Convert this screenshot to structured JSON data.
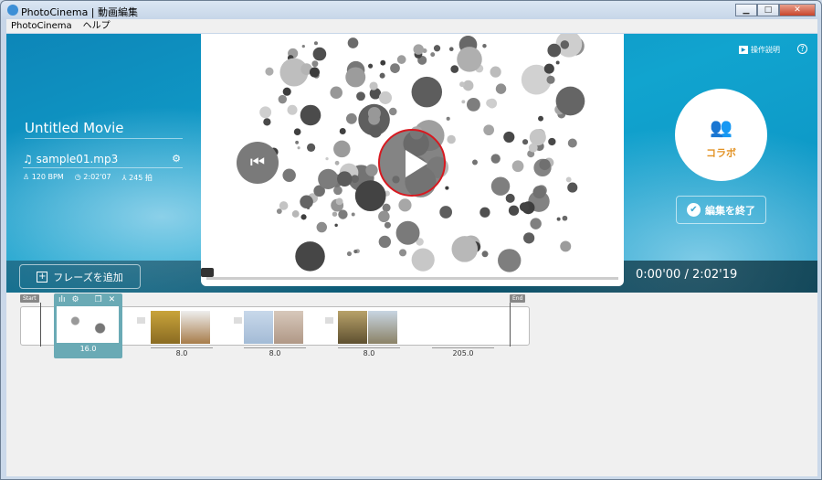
{
  "window": {
    "title": "PhotoCinema | 動画編集",
    "minimize": "▁",
    "maximize": "□",
    "close": "✕"
  },
  "menu": [
    "PhotoCinema",
    "ヘルプ"
  ],
  "movie": {
    "title": "Untitled Movie",
    "music_file": "sample01.mp3",
    "bpm": "120 BPM",
    "duration": "2:02'07",
    "beats": "245 拍"
  },
  "buttons": {
    "add_phrase": "フレーズを追加",
    "collab": "コラボ",
    "finish_editing": "編集を終了",
    "help": "操作説明",
    "question": "?"
  },
  "player": {
    "time": "0:00'00 / 2:02'19",
    "progress": 0
  },
  "timeline": {
    "start_label": "Start",
    "end_label": "End",
    "phrases": [
      {
        "duration": "16.0",
        "selected": true
      },
      {
        "duration": "8.0"
      },
      {
        "duration": "8.0"
      },
      {
        "duration": "8.0"
      }
    ],
    "tail_duration": "205.0"
  },
  "colors": {
    "accent": "#e39325",
    "stage": "#11a4cf",
    "play_ring": "#d71920",
    "selected_clip": "#6aaab5"
  }
}
